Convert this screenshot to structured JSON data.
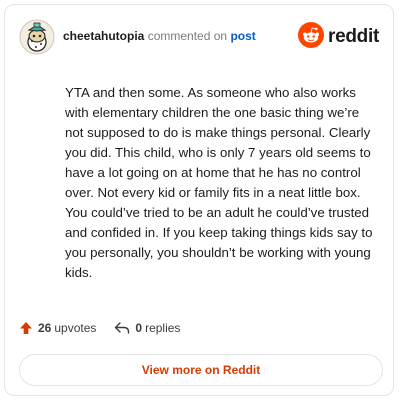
{
  "header": {
    "username": "cheetahutopia",
    "action": "commented on",
    "post_link": "post",
    "brand": "reddit"
  },
  "comment": {
    "text": "YTA and then some. As someone who also works with elementary children the one basic thing we’re not supposed to do is make things personal. Clearly you did. This child, who is only 7 years old seems to have a lot going on at home that he has no control over. Not every kid or family fits in a neat little box. You could’ve tried to be an adult he could’ve trusted and confided in. If you keep taking things kids say to you personally, you shouldn’t be working with young kids."
  },
  "stats": {
    "upvote_count": "26",
    "upvote_word": "upvotes",
    "reply_count": "0",
    "reply_word": "replies"
  },
  "actions": {
    "view_button_label": "View more on Reddit"
  },
  "icons": {
    "avatar": "snoo-avatar-icon",
    "reddit": "reddit-logo-icon",
    "upvote": "upvote-arrow-icon",
    "reply": "reply-arrow-icon"
  },
  "colors": {
    "reddit_orange": "#FF4500",
    "upvote_arrow": "#D93A00",
    "link_blue": "#0A5BC4",
    "button_text": "#D93A00"
  }
}
